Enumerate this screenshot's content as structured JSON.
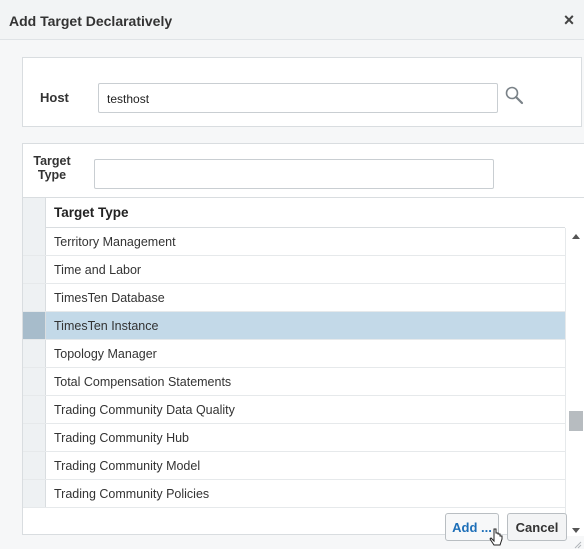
{
  "dialog": {
    "title": "Add Target Declaratively",
    "close_glyph": "×"
  },
  "host": {
    "label": "Host",
    "value": "testhost",
    "search_icon": "magnifier-icon"
  },
  "target_type_filter": {
    "label": "Target Type",
    "value": ""
  },
  "grid": {
    "column_header": "Target Type",
    "rows": [
      "Territory Management",
      "Time and Labor",
      "TimesTen Database",
      "TimesTen Instance",
      "Topology Manager",
      "Total Compensation Statements",
      "Trading Community Data Quality",
      "Trading Community Hub",
      "Trading Community Model",
      "Trading Community Policies"
    ],
    "selected_row": "TimesTen Instance"
  },
  "buttons": {
    "add": "Add ...",
    "cancel": "Cancel"
  },
  "colors": {
    "selected_row_bg": "#c3d9e8",
    "add_button_text": "#1d6fb8"
  }
}
